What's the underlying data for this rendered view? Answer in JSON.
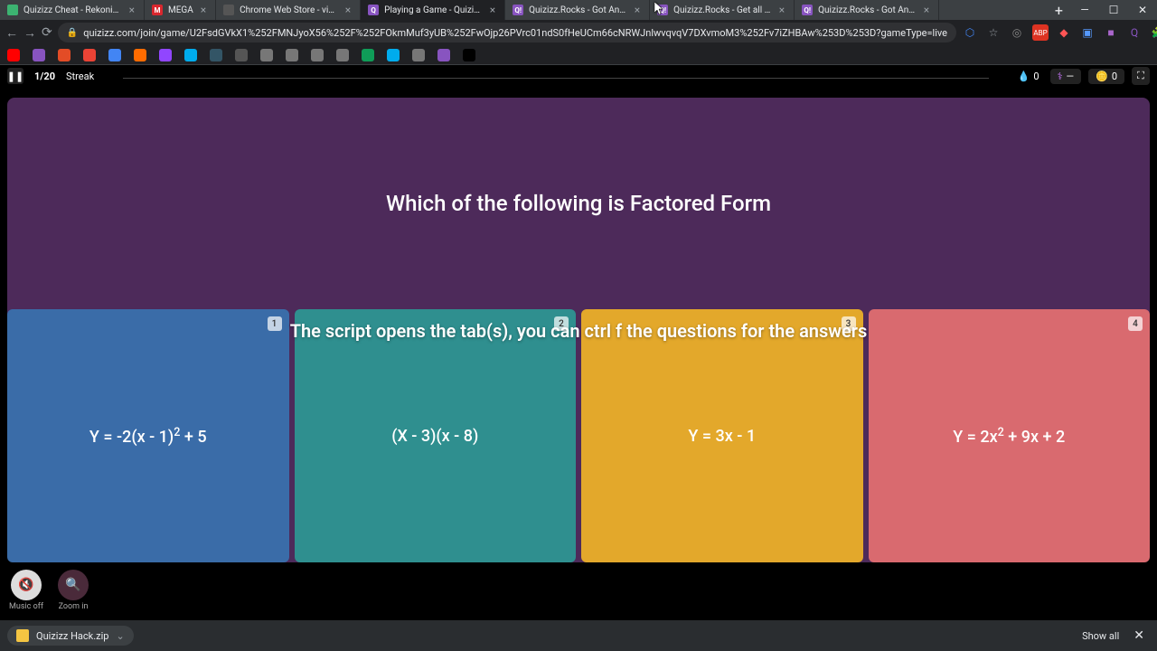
{
  "browser_tabs": [
    {
      "title": "Quizizz Cheat - Rekonise",
      "favcolor": "#3cb371",
      "favtext": ""
    },
    {
      "title": "MEGA",
      "favcolor": "#d9272e",
      "favtext": "M"
    },
    {
      "title": "Chrome Web Store - violetmonk",
      "favcolor": "#555",
      "favtext": ""
    },
    {
      "title": "Playing a Game - Quizizz",
      "favcolor": "#8854c0",
      "favtext": "Q",
      "active": true
    },
    {
      "title": "Quizizz.Rocks - Got Answers :)",
      "favcolor": "#8854c0",
      "favtext": "Q!"
    },
    {
      "title": "Quizizz.Rocks - Get all the answe",
      "favcolor": "#8854c0",
      "favtext": "Q!"
    },
    {
      "title": "Quizizz.Rocks - Got Answers :)",
      "favcolor": "#8854c0",
      "favtext": "Q!"
    }
  ],
  "url": "quizizz.com/join/game/U2FsdGVkX1%252FMNJyoX56%252F%252FOkmMuf3yUB%252FwOjp26PVrc01ndS0fHeUCm66cNRWJnlwvqvqV7DXvmoM3%252Fv7iZHBAw%253D%253D?gameType=live",
  "bookmark_colors": [
    "#ff0000",
    "#8854c0",
    "#e34c26",
    "#ea4335",
    "#4285f4",
    "#ff6b00",
    "#9146ff",
    "#00aced",
    "#356",
    "#555",
    "#777",
    "#777",
    "#777",
    "#777",
    "#0f9d58",
    "#00aced",
    "#777",
    "#8854c0",
    "#000"
  ],
  "game": {
    "progress": "1/20",
    "streak_label": "Streak",
    "drops": "0",
    "powerup": "—",
    "coins": "0",
    "question": "Which of the following is Factored Form",
    "answers": [
      {
        "num": "1",
        "html": "Y = -2(x - 1)<sup>2</sup> + 5"
      },
      {
        "num": "2",
        "html": "(X - 3)(x - 8)"
      },
      {
        "num": "3",
        "html": "Y = 3x - 1"
      },
      {
        "num": "4",
        "html": "Y = 2x<sup>2</sup> + 9x + 2"
      }
    ],
    "music_label": "Music off",
    "zoom_label": "Zoom in"
  },
  "overlay_text": "The script opens the tab(s), you can ctrl f the questions for the answers",
  "download": {
    "file": "Quizizz Hack.zip",
    "showall": "Show all"
  }
}
